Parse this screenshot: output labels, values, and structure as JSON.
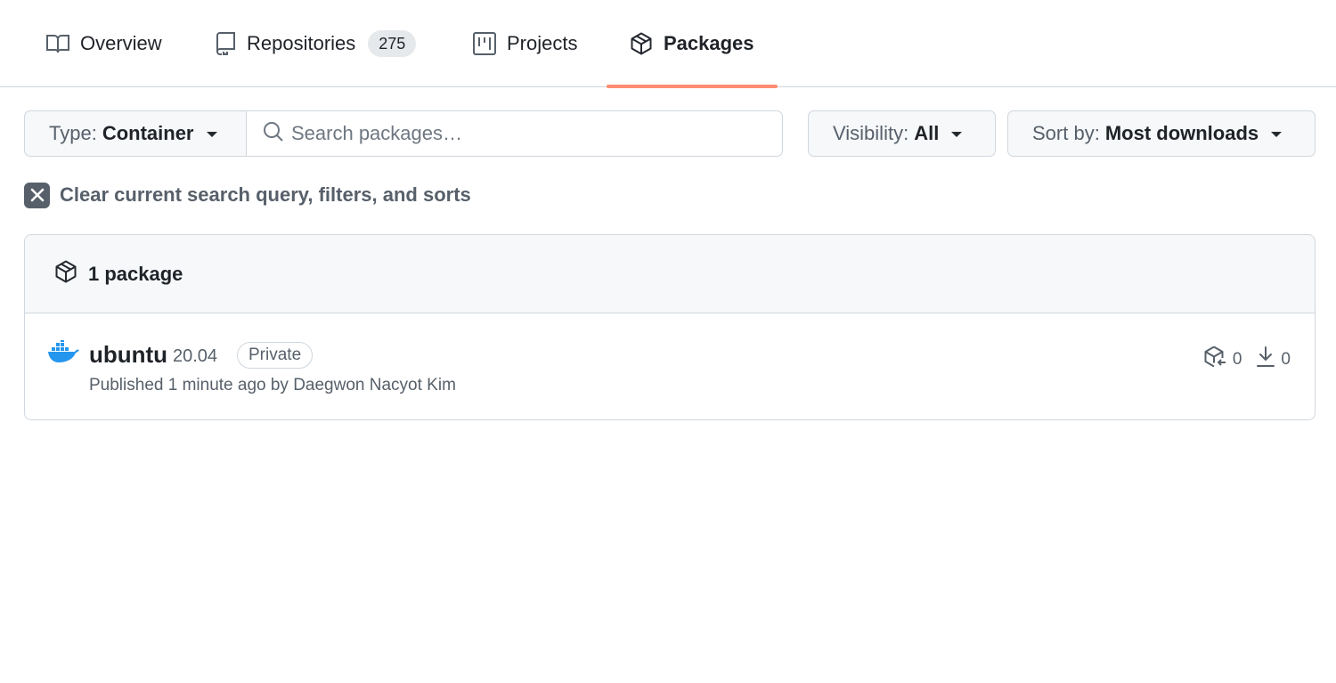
{
  "nav": {
    "tabs": [
      {
        "label": "Overview",
        "icon": "book-icon"
      },
      {
        "label": "Repositories",
        "icon": "repo-icon",
        "count": "275"
      },
      {
        "label": "Projects",
        "icon": "project-icon"
      },
      {
        "label": "Packages",
        "icon": "package-icon",
        "selected": true
      }
    ]
  },
  "filters": {
    "type_prefix": "Type:",
    "type_value": "Container",
    "search_placeholder": "Search packages…",
    "visibility_prefix": "Visibility:",
    "visibility_value": "All",
    "sort_prefix": "Sort by:",
    "sort_value": "Most downloads"
  },
  "clear_filters_label": "Clear current search query, filters, and sorts",
  "list": {
    "count_label": "1 package",
    "packages": [
      {
        "name": "ubuntu",
        "version": "20.04",
        "visibility_label": "Private",
        "published": "Published 1 minute ago by Daegwon Nacyot Kim",
        "versions_count": "0",
        "downloads_count": "0",
        "icon": "docker-icon"
      }
    ]
  },
  "colors": {
    "accent_underline": "#fd8c73",
    "docker_blue": "#2496ed",
    "muted_text": "#57606a",
    "border": "#d0d7de"
  }
}
